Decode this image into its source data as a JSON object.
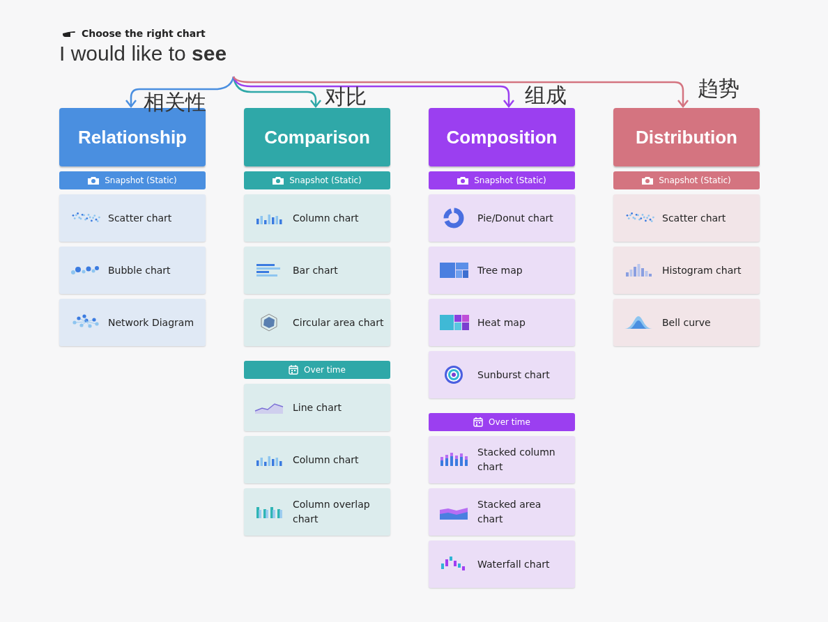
{
  "header": {
    "eyebrow": "Choose the right chart",
    "headline": "I would like to **see**"
  },
  "columns": [
    {
      "title": "Relationship",
      "label": "相关性",
      "color": "#4a8fe0",
      "sections": [
        {
          "kind": "snapshot",
          "label": "Snapshot (Static)",
          "items": [
            {
              "kind": "scatter",
              "label": "Scatter chart"
            },
            {
              "kind": "bubble",
              "label": "Bubble chart"
            },
            {
              "kind": "network",
              "label": "Network Diagram"
            }
          ]
        }
      ]
    },
    {
      "title": "Comparison",
      "label": "对比",
      "color": "#2fa8a8",
      "sections": [
        {
          "kind": "snapshot",
          "label": "Snapshot (Static)",
          "items": [
            {
              "kind": "column",
              "label": "Column chart"
            },
            {
              "kind": "bar",
              "label": "Bar chart"
            },
            {
              "kind": "radar",
              "label": "Circular area chart"
            }
          ]
        },
        {
          "kind": "overtime",
          "label": "Over time",
          "items": [
            {
              "kind": "line",
              "label": "Line chart"
            },
            {
              "kind": "column",
              "label": "Column chart"
            },
            {
              "kind": "overlap",
              "label": "Column overlap chart"
            }
          ]
        }
      ]
    },
    {
      "title": "Composition",
      "label": "组成",
      "color": "#9b3ff0",
      "sections": [
        {
          "kind": "snapshot",
          "label": "Snapshot (Static)",
          "items": [
            {
              "kind": "pie",
              "label": "Pie/Donut chart"
            },
            {
              "kind": "treemap",
              "label": "Tree map"
            },
            {
              "kind": "heatmap",
              "label": "Heat map"
            },
            {
              "kind": "sunburst",
              "label": "Sunburst chart"
            }
          ]
        },
        {
          "kind": "overtime",
          "label": "Over time",
          "items": [
            {
              "kind": "stacked-column",
              "label": "Stacked column chart"
            },
            {
              "kind": "stacked-area",
              "label": "Stacked area chart"
            },
            {
              "kind": "waterfall",
              "label": "Waterfall chart"
            }
          ]
        }
      ]
    },
    {
      "title": "Distribution",
      "label": "趋势",
      "color": "#d47480",
      "sections": [
        {
          "kind": "snapshot",
          "label": "Snapshot (Static)",
          "items": [
            {
              "kind": "scatter",
              "label": "Scatter chart"
            },
            {
              "kind": "histogram",
              "label": "Histogram chart"
            },
            {
              "kind": "bell",
              "label": "Bell curve"
            }
          ]
        }
      ]
    }
  ]
}
